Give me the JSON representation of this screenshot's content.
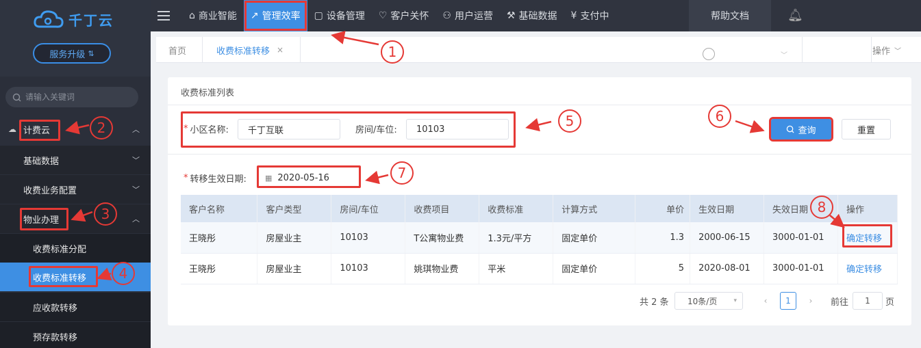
{
  "app": {
    "logo_text": "千丁云",
    "upgrade_label": "服务升级"
  },
  "sidebar": {
    "search_placeholder": "请输入关键词",
    "items": [
      {
        "label": "计费云"
      },
      {
        "label": "基础数据"
      },
      {
        "label": "收费业务配置"
      },
      {
        "label": "物业办理"
      },
      {
        "label": "收费标准分配"
      },
      {
        "label": "收费标准转移"
      },
      {
        "label": "应收款转移"
      },
      {
        "label": "预存款转移"
      }
    ]
  },
  "topnav": {
    "items": [
      {
        "label": "商业智能",
        "icon": "building-icon"
      },
      {
        "label": "管理效率",
        "icon": "chart-line-icon"
      },
      {
        "label": "设备管理",
        "icon": "device-icon"
      },
      {
        "label": "客户关怀",
        "icon": "heart-icon"
      },
      {
        "label": "用户运营",
        "icon": "user-ops-icon"
      },
      {
        "label": "基础数据",
        "icon": "wrench-icon"
      },
      {
        "label": "支付中",
        "icon": "yuan-icon"
      }
    ],
    "help": "帮助文档"
  },
  "tabs": {
    "home": "首页",
    "current": "收费标准转移",
    "ops": "操作"
  },
  "card": {
    "title": "收费标准列表"
  },
  "form": {
    "community_label": "小区名称:",
    "community_value": "千丁互联",
    "room_label": "房间/车位:",
    "room_value": "10103",
    "date_label": "转移生效日期:",
    "date_value": "2020-05-16",
    "search_button": "查询",
    "reset_button": "重置"
  },
  "table": {
    "headers": [
      "客户名称",
      "客户类型",
      "房间/车位",
      "收费项目",
      "收费标准",
      "计算方式",
      "单价",
      "生效日期",
      "失效日期",
      "操作"
    ],
    "rows": [
      [
        "王晓彤",
        "房屋业主",
        "10103",
        "T公寓物业费",
        "1.3元/平方",
        "固定单价",
        "1.3",
        "2000-06-15",
        "3000-01-01",
        "确定转移"
      ],
      [
        "王晓彤",
        "房屋业主",
        "10103",
        "姚琪物业费",
        "平米",
        "固定单价",
        "5",
        "2020-08-01",
        "3000-01-01",
        "确定转移"
      ]
    ]
  },
  "pagination": {
    "total": "共 2 条",
    "page_size": "10条/页",
    "current": "1",
    "goto_label": "前往",
    "goto_value": "1",
    "page_suffix": "页"
  },
  "annotations": [
    "1",
    "2",
    "3",
    "4",
    "5",
    "6",
    "7",
    "8"
  ],
  "colors": {
    "accent": "#3e8fe3",
    "annotation": "#e53935",
    "sidebar_bg": "#2b2f3a",
    "topbar_bg": "#30343f"
  }
}
